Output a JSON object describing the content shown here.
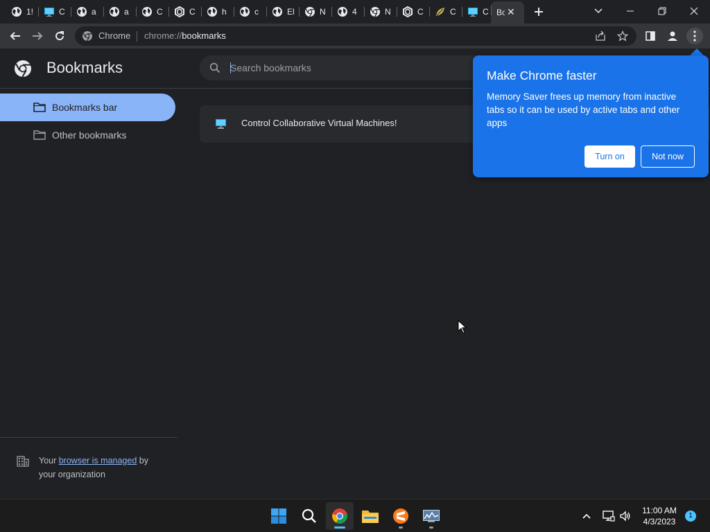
{
  "tabs": [
    {
      "title": "1!",
      "icon": "globe-icon"
    },
    {
      "title": "C",
      "icon": "vm-monitor-icon"
    },
    {
      "title": "a",
      "icon": "globe-icon"
    },
    {
      "title": "a",
      "icon": "globe-icon"
    },
    {
      "title": "C",
      "icon": "globe-icon"
    },
    {
      "title": "C",
      "icon": "ai-knot-icon"
    },
    {
      "title": "h",
      "icon": "globe-icon"
    },
    {
      "title": "c",
      "icon": "globe-icon"
    },
    {
      "title": "El",
      "icon": "globe-icon"
    },
    {
      "title": "N",
      "icon": "chrome-icon"
    },
    {
      "title": "4",
      "icon": "globe-icon"
    },
    {
      "title": "N",
      "icon": "chrome-icon"
    },
    {
      "title": "C",
      "icon": "ai-knot-icon"
    },
    {
      "title": "C",
      "icon": "leaf-icon"
    },
    {
      "title": "C",
      "icon": "vm-monitor-icon"
    },
    {
      "title": "Bo",
      "icon": "none",
      "active": true
    }
  ],
  "omnibox": {
    "site_label": "Chrome",
    "url_scheme": "chrome://",
    "url_host": "bookmarks"
  },
  "page": {
    "title": "Bookmarks",
    "search_placeholder": "Search bookmarks"
  },
  "sidebar": {
    "items": [
      {
        "label": "Bookmarks bar",
        "selected": true
      },
      {
        "label": "Other bookmarks",
        "selected": false
      }
    ],
    "managed": {
      "prefix": "Your ",
      "link": "browser is managed",
      "suffix": " by",
      "line2": "your organization"
    }
  },
  "bookmarks": [
    {
      "title": "Control Collaborative Virtual Machines!",
      "icon": "vm-monitor-icon"
    }
  ],
  "promo": {
    "title": "Make Chrome faster",
    "body": "Memory Saver frees up memory from inactive tabs so it can be used by active tabs and other apps",
    "primary_button": "Turn on",
    "secondary_button": "Not now"
  },
  "taskbar": {
    "time": "11:00 AM",
    "date": "4/3/2023",
    "notification_count": "1"
  },
  "colors": {
    "accent_blue": "#1a73e8",
    "selected_item": "#8ab4f8",
    "background": "#202124"
  }
}
